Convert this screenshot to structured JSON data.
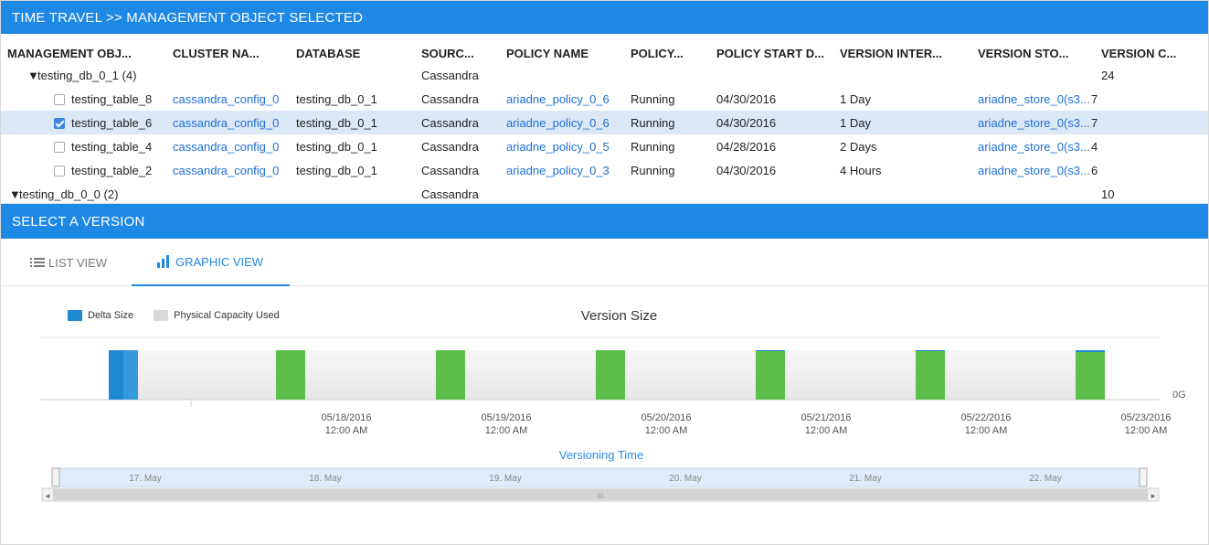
{
  "top_panel": {
    "title": "TIME TRAVEL >> MANAGEMENT OBJECT SELECTED"
  },
  "table": {
    "columns": [
      "MANAGEMENT OBJ...",
      "CLUSTER NA...",
      "DATABASE",
      "SOURC...",
      "POLICY NAME",
      "POLICY...",
      "POLICY START D...",
      "VERSION INTER...",
      "VERSION STO...",
      "VERSION C..."
    ],
    "groups": [
      {
        "label": "testing_db_0_1 (4)",
        "source": "Cassandra",
        "count": "24"
      },
      {
        "label": "testing_db_0_0 (2)",
        "source": "Cassandra",
        "count": "10"
      }
    ],
    "rows": [
      {
        "name": "testing_table_8",
        "cluster": "cassandra_config_0",
        "database": "testing_db_0_1",
        "source": "Cassandra",
        "policy": "ariadne_policy_0_6",
        "status": "Running",
        "start": "04/30/2016",
        "interval": "1 Day",
        "store": "ariadne_store_0(s3...",
        "count": "7",
        "checked": false
      },
      {
        "name": "testing_table_6",
        "cluster": "cassandra_config_0",
        "database": "testing_db_0_1",
        "source": "Cassandra",
        "policy": "ariadne_policy_0_6",
        "status": "Running",
        "start": "04/30/2016",
        "interval": "1 Day",
        "store": "ariadne_store_0(s3...",
        "count": "7",
        "checked": true
      },
      {
        "name": "testing_table_4",
        "cluster": "cassandra_config_0",
        "database": "testing_db_0_1",
        "source": "Cassandra",
        "policy": "ariadne_policy_0_5",
        "status": "Running",
        "start": "04/28/2016",
        "interval": "2 Days",
        "store": "ariadne_store_0(s3...",
        "count": "4",
        "checked": false
      },
      {
        "name": "testing_table_2",
        "cluster": "cassandra_config_0",
        "database": "testing_db_0_1",
        "source": "Cassandra",
        "policy": "ariadne_policy_0_3",
        "status": "Running",
        "start": "04/30/2016",
        "interval": "4 Hours",
        "store": "ariadne_store_0(s3...",
        "count": "6",
        "checked": false
      }
    ]
  },
  "version_panel": {
    "title": "SELECT A VERSION"
  },
  "tabs": [
    {
      "label": "LIST VIEW",
      "icon": "list-icon",
      "active": false
    },
    {
      "label": "GRAPHIC VIEW",
      "icon": "bar-chart-icon",
      "active": true
    }
  ],
  "colors": {
    "header_bg": "#1e88e5",
    "delta": "#1b8ad3",
    "physical": "#d9d9d9",
    "green": "#5cbf4a",
    "selected_row": "#dce8f6"
  },
  "chart_data": {
    "type": "bar",
    "title": "Version Size",
    "xlabel": "Versioning Time",
    "legend": [
      "Delta Size",
      "Physical Capacity Used"
    ],
    "y_tick_label": "0G",
    "x_ticks": [
      {
        "date": "05/18/2016",
        "time": "12:00 AM"
      },
      {
        "date": "05/19/2016",
        "time": "12:00 AM"
      },
      {
        "date": "05/20/2016",
        "time": "12:00 AM"
      },
      {
        "date": "05/21/2016",
        "time": "12:00 AM"
      },
      {
        "date": "05/22/2016",
        "time": "12:00 AM"
      },
      {
        "date": "05/23/2016",
        "time": "12:00 AM"
      }
    ],
    "versions": [
      {
        "date": "05/17/2016",
        "delta_share": 1.0,
        "highlighted": true
      },
      {
        "date": "05/18/2016",
        "delta_share": 0.0,
        "highlighted": false
      },
      {
        "date": "05/19/2016",
        "delta_share": 0.0,
        "highlighted": false
      },
      {
        "date": "05/20/2016",
        "delta_share": 0.0,
        "highlighted": false
      },
      {
        "date": "05/21/2016",
        "delta_share": 0.02,
        "highlighted": false
      },
      {
        "date": "05/22/2016",
        "delta_share": 0.02,
        "highlighted": false
      },
      {
        "date": "05/23/2016",
        "delta_share": 0.04,
        "highlighted": false
      }
    ],
    "navigator_labels": [
      "17. May",
      "18. May",
      "19. May",
      "20. May",
      "21. May",
      "22. May"
    ],
    "scrollbar_grip": "III"
  }
}
